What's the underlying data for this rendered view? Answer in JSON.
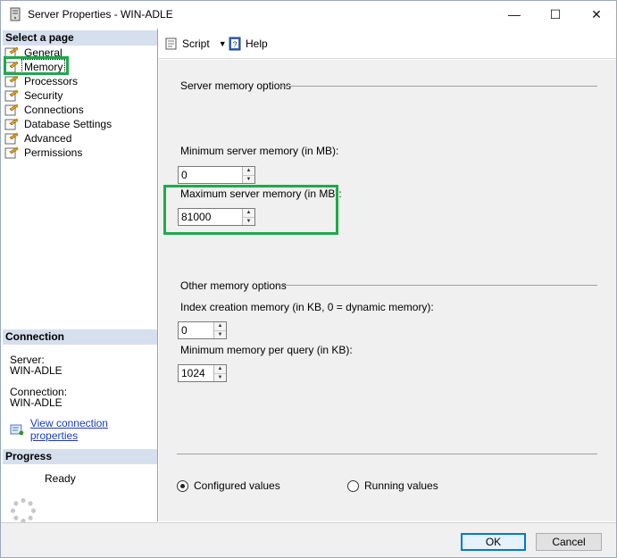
{
  "window": {
    "title": "Server Properties - WIN-ADLE",
    "minimize": "—",
    "maximize": "☐",
    "close": "✕"
  },
  "left": {
    "select_page_header": "Select a page",
    "pages": [
      {
        "label": "General",
        "icon": "page-icon"
      },
      {
        "label": "Memory",
        "icon": "page-icon",
        "selected": true
      },
      {
        "label": "Processors",
        "icon": "page-icon"
      },
      {
        "label": "Security",
        "icon": "page-icon"
      },
      {
        "label": "Connections",
        "icon": "page-icon"
      },
      {
        "label": "Database Settings",
        "icon": "page-icon"
      },
      {
        "label": "Advanced",
        "icon": "page-icon"
      },
      {
        "label": "Permissions",
        "icon": "page-icon"
      }
    ],
    "connection_header": "Connection",
    "server_label": "Server:",
    "server_value": "WIN-ADLE",
    "connection_label": "Connection:",
    "connection_value": "WIN-ADLE",
    "view_props_link": "View connection properties",
    "progress_header": "Progress",
    "progress_status": "Ready"
  },
  "toolbar": {
    "script_label": "Script",
    "help_label": "Help"
  },
  "content": {
    "server_memory_title": "Server memory options",
    "min_label": "Minimum server memory (in MB):",
    "min_value": "0",
    "max_label": "Maximum server memory (in MB):",
    "max_value": "81000",
    "other_title": "Other memory options",
    "index_label": "Index creation memory (in KB, 0 = dynamic memory):",
    "index_value": "0",
    "min_query_label": "Minimum memory per query (in KB):",
    "min_query_value": "1024",
    "radio_configured": "Configured values",
    "radio_running": "Running values"
  },
  "footer": {
    "ok_label": "OK",
    "cancel_label": "Cancel"
  },
  "colors": {
    "highlight": "#1fa84a",
    "section_header_bg": "#d6dfee",
    "link": "#1a3fb6",
    "ok_border": "#0078d7"
  }
}
